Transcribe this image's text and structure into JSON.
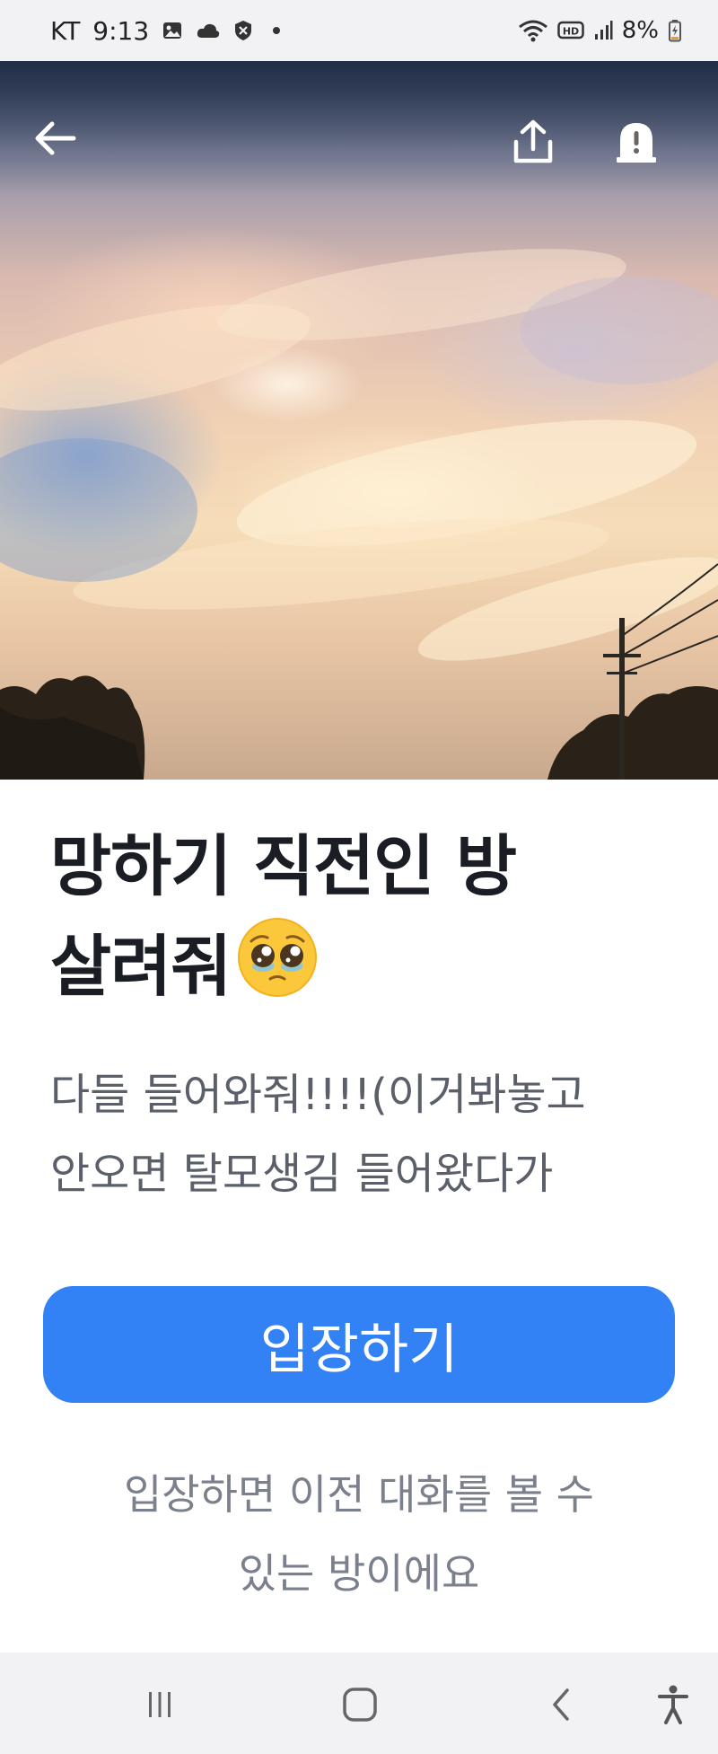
{
  "status_bar": {
    "carrier": "KT",
    "time": "9:13",
    "battery": "8%",
    "icons": [
      "gallery-icon",
      "cloud-icon",
      "shield-icon",
      "wifi-icon",
      "hd-icon",
      "signal-icon",
      "battery-icon"
    ]
  },
  "hero": {
    "icons": {
      "back": "arrow-left-icon",
      "share": "share-icon",
      "report": "report-icon"
    }
  },
  "room": {
    "title_line1": "망하기 직전인 방",
    "title_line2": "살려줘",
    "title_emoji": "pleading-face-emoji",
    "description_line1": "다들 들어와줘!!!!(이거봐놓고",
    "description_line2": "안오면 탈모생김 들어왔다가"
  },
  "enter_button": {
    "label": "입장하기"
  },
  "notice": {
    "line1": "입장하면 이전 대화를 볼 수",
    "line2": "있는 방이에요"
  },
  "nav_bar": {
    "icons": [
      "recent-apps-icon",
      "home-icon",
      "back-icon",
      "accessibility-icon"
    ]
  },
  "colors": {
    "accent": "#3281f5",
    "title": "#1a1d24",
    "description": "#5a5f6a",
    "notice": "#7a808c",
    "system_bar": "#f2f2f4"
  }
}
